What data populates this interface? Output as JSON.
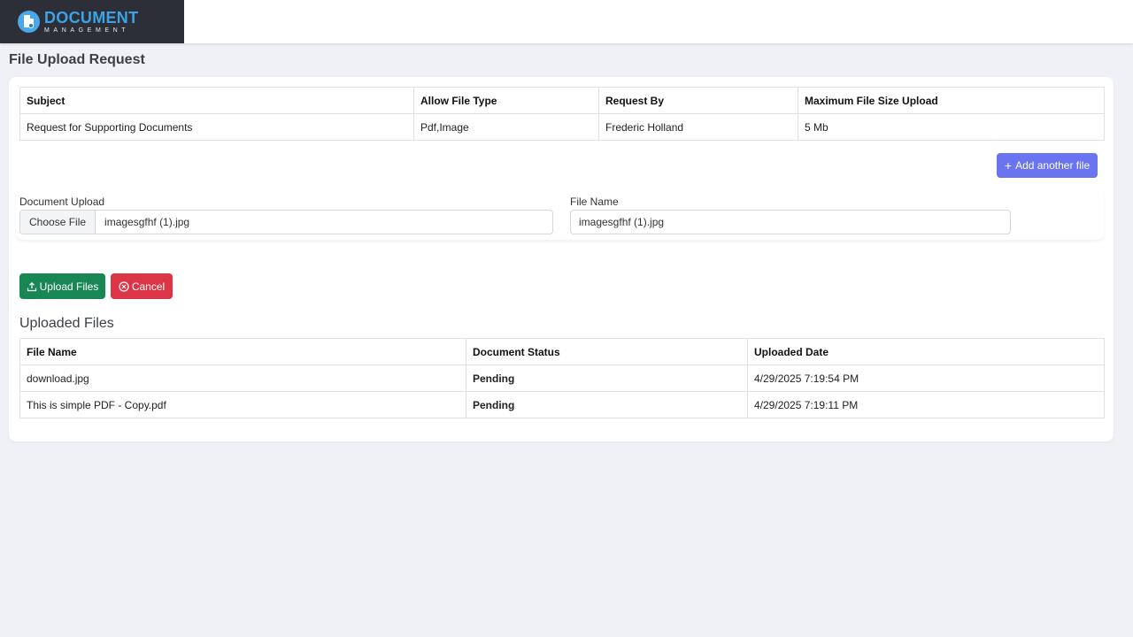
{
  "brand": {
    "title": "DOCUMENT",
    "subtitle": "MANAGEMENT"
  },
  "page_title": "File Upload Request",
  "request_table": {
    "headers": [
      "Subject",
      "Allow File Type",
      "Request By",
      "Maximum File Size Upload"
    ],
    "row": [
      "Request for Supporting Documents",
      "Pdf,Image",
      "Frederic Holland",
      "5 Mb"
    ]
  },
  "add_button_label": "Add another file",
  "upload_form": {
    "document_upload_label": "Document Upload",
    "choose_file_label": "Choose File",
    "chosen_file": "imagesgfhf (1).jpg",
    "file_name_label": "File Name",
    "file_name_value": "imagesgfhf (1).jpg"
  },
  "actions": {
    "upload_label": "Upload Files",
    "cancel_label": "Cancel"
  },
  "uploaded_files": {
    "title": "Uploaded Files",
    "headers": [
      "File Name",
      "Document Status",
      "Uploaded Date"
    ],
    "rows": [
      [
        "download.jpg",
        "Pending",
        "4/29/2025 7:19:54 PM"
      ],
      [
        "This is simple PDF - Copy.pdf",
        "Pending",
        "4/29/2025 7:19:11 PM"
      ]
    ]
  },
  "colors": {
    "accent": "#6a73f0",
    "upload": "#198754",
    "cancel": "#dc3545",
    "pending": "#f5a000",
    "brand": "#3da3e6"
  }
}
